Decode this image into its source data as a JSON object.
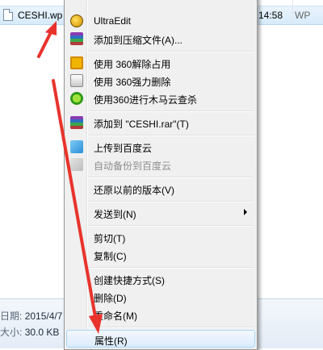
{
  "explorer": {
    "top_file_partial": "...",
    "selected_file": {
      "name": "CESHI.wp",
      "time": "14:58",
      "type": "WP"
    },
    "details": {
      "date_label": "日期:",
      "date_value": "2015/4/7",
      "size_label": "大小:",
      "size_value": "30.0 KB"
    }
  },
  "menu": {
    "items": [
      {
        "label": "UltraEdit",
        "icon": "ultraedit-icon"
      },
      {
        "label": "添加到压缩文件(A)...",
        "icon": "winrar-icon"
      },
      {
        "label": "使用 360解除占用",
        "icon": "360-unlock-icon"
      },
      {
        "label": "使用 360强力删除",
        "icon": "360-shred-icon"
      },
      {
        "label": "使用360进行木马云查杀",
        "icon": "360-scan-icon"
      },
      {
        "label": "添加到 \"CESHI.rar\"(T)",
        "icon": "winrar-icon"
      },
      {
        "label": "上传到百度云",
        "icon": "baidu-cloud-icon"
      },
      {
        "label": "自动备份到百度云",
        "icon": "baidu-cloud-disabled-icon"
      },
      {
        "label": "还原以前的版本(V)"
      },
      {
        "label": "发送到(N)"
      },
      {
        "label": "剪切(T)"
      },
      {
        "label": "复制(C)"
      },
      {
        "label": "创建快捷方式(S)"
      },
      {
        "label": "删除(D)"
      },
      {
        "label": "重命名(M)"
      },
      {
        "label": "属性(R)"
      }
    ]
  },
  "colors": {
    "arrow": "#e8332c",
    "hover_border": "#a8d8f8",
    "menu_bg": "#f0f0f0"
  }
}
